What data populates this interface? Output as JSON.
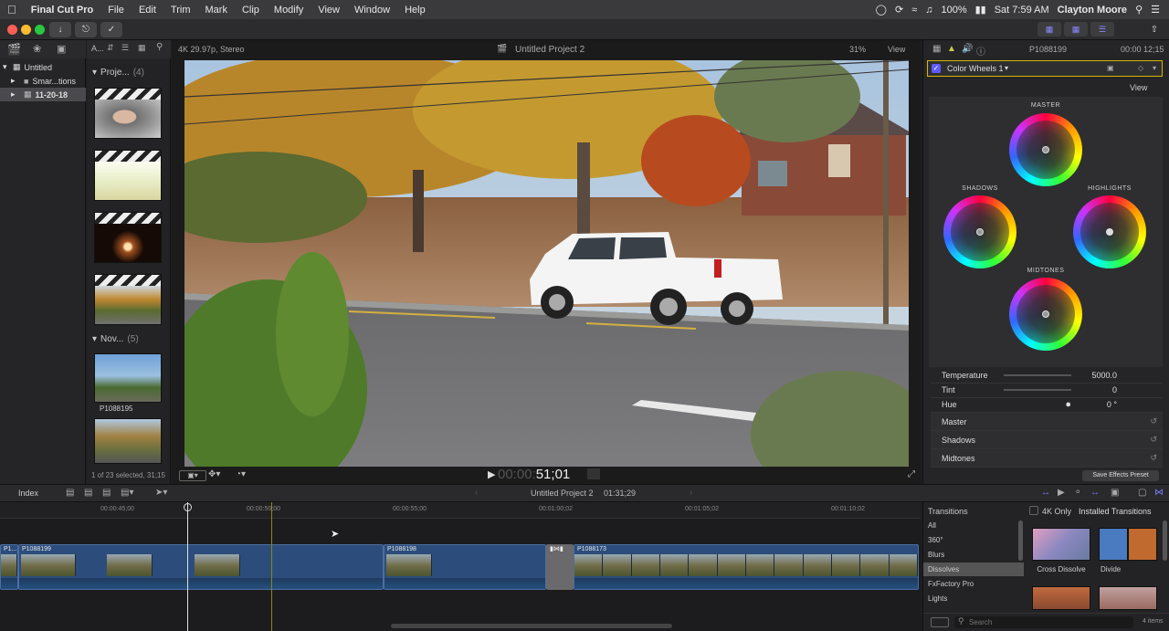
{
  "menubar": {
    "app": "Final Cut Pro",
    "items": [
      "File",
      "Edit",
      "Trim",
      "Mark",
      "Clip",
      "Modify",
      "View",
      "Window",
      "Help"
    ],
    "battery": "100%",
    "user": "Clayton Moore",
    "time": "Sat 7:59 AM"
  },
  "library": {
    "header_sort": "A...",
    "items": [
      "Untitled",
      "Smar...tions",
      "11-20-18"
    ]
  },
  "browser": {
    "groups": [
      {
        "name": "Proje...",
        "count": "(4)"
      },
      {
        "name": "Nov...",
        "count": "(5)"
      }
    ],
    "clip_label": "P1088195",
    "status": "1 of 23 selected, 31;15"
  },
  "viewer": {
    "format": "4K 29.97p, Stereo",
    "title": "Untitled Project 2",
    "zoom": "31%",
    "view_label": "View",
    "timecode_dim": "00:00:",
    "timecode": "51;01"
  },
  "inspector": {
    "clip": "P1088199",
    "duration": "00:00 12;15",
    "effect": "Color Wheels 1",
    "view_label": "View",
    "wheels": [
      "MASTER",
      "SHADOWS",
      "HIGHLIGHTS",
      "MIDTONES"
    ],
    "params": [
      {
        "name": "Temperature",
        "value": "5000.0"
      },
      {
        "name": "Tint",
        "value": "0"
      },
      {
        "name": "Hue",
        "value": "0 °"
      }
    ],
    "sections": [
      "Master",
      "Shadows",
      "Midtones"
    ],
    "save_preset": "Save Effects Preset"
  },
  "timeline": {
    "index": "Index",
    "project": "Untitled Project 2",
    "duration": "01:31;29",
    "ruler": [
      "00:00:45;00",
      "00:00:50;00",
      "00:00:55;00",
      "00:01:00;02",
      "00:01:05;02",
      "00:01:10;02"
    ],
    "clips": [
      "P1...",
      "P1088199",
      "P1088198",
      "P1088173"
    ]
  },
  "transitions": {
    "title": "Transitions",
    "filter": "4K Only",
    "installed": "Installed Transitions",
    "categories": [
      "All",
      "360°",
      "Blurs",
      "Dissolves",
      "FxFactory Pro",
      "Lights"
    ],
    "thumbs": [
      "Cross Dissolve",
      "Divide"
    ],
    "search_placeholder": "Search",
    "count": "4 items"
  },
  "colors": {
    "accent": "#5d5dff",
    "clip": "#2c4d7b",
    "selection_yellow": "#d4b800"
  }
}
